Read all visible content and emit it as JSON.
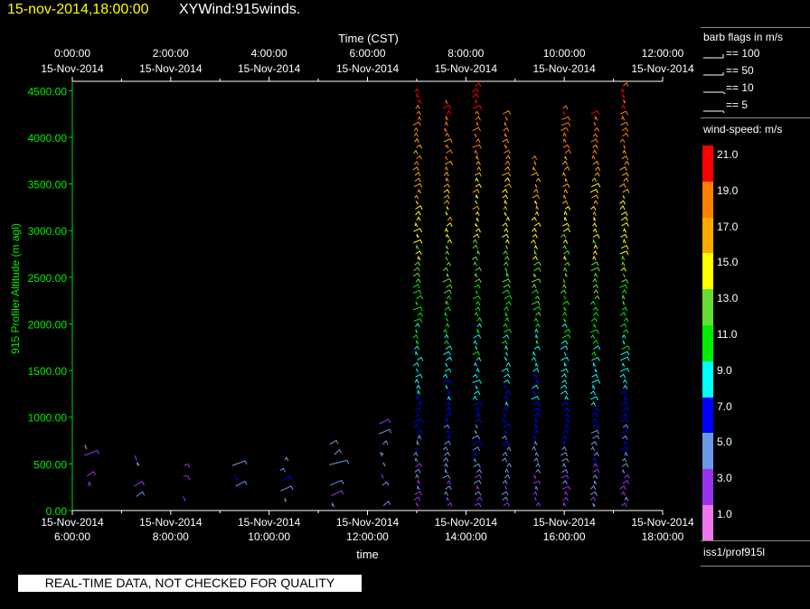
{
  "header": {
    "date_time": "15-nov-2014,18:00:00",
    "plot_name": "XYWind:915winds."
  },
  "legend": {
    "barb_title": "barb flags in m/s",
    "barbs": [
      {
        "label": "== 100",
        "icon": "barb-flag-100-icon"
      },
      {
        "label": "== 50",
        "icon": "barb-flag-50-icon"
      },
      {
        "label": "== 10",
        "icon": "barb-flag-10-icon"
      },
      {
        "label": "== 5",
        "icon": "barb-flag-5-icon"
      }
    ],
    "speed_title": "wind-speed: m/s",
    "color_scale": [
      {
        "label": "21.0",
        "color": "#ff0000"
      },
      {
        "label": "19.0",
        "color": "#ff8000"
      },
      {
        "label": "17.0",
        "color": "#ffaa00"
      },
      {
        "label": "15.0",
        "color": "#ffff00"
      },
      {
        "label": "13.0",
        "color": "#66dd33"
      },
      {
        "label": "11.0",
        "color": "#00ee00"
      },
      {
        "label": "9.0",
        "color": "#00ffff"
      },
      {
        "label": "7.0",
        "color": "#0000ff"
      },
      {
        "label": "5.0",
        "color": "#6a9ae6"
      },
      {
        "label": "3.0",
        "color": "#9a33ee"
      },
      {
        "label": "1.0",
        "color": "#ee77ee"
      }
    ],
    "source": "iss1/prof915l"
  },
  "quality_note": "REAL-TIME DATA, NOT CHECKED FOR QUALITY",
  "chart_data": {
    "type": "scatter",
    "top_axis_title": "Time (CST)",
    "xlabel": "time",
    "ylabel": "915 Profiler Altitude (m agl)",
    "ylim": [
      0,
      4600
    ],
    "x_range_hours": [
      6,
      18
    ],
    "yticks": [
      "0.00",
      "500.00",
      "1000.00",
      "1500.00",
      "2000.00",
      "2500.00",
      "3000.00",
      "3500.00",
      "4000.00",
      "4500.00"
    ],
    "bottom_ticks": [
      {
        "line1": "15-Nov-2014",
        "line2": "6:00:00"
      },
      {
        "line1": "15-Nov-2014",
        "line2": "8:00:00"
      },
      {
        "line1": "15-Nov-2014",
        "line2": "10:00:00"
      },
      {
        "line1": "15-Nov-2014",
        "line2": "12:00:00"
      },
      {
        "line1": "15-Nov-2014",
        "line2": "14:00:00"
      },
      {
        "line1": "15-Nov-2014",
        "line2": "16:00:00"
      },
      {
        "line1": "15-Nov-2014",
        "line2": "18:00:00"
      }
    ],
    "top_ticks": [
      {
        "line1": "0:00:00",
        "line2": "15-Nov-2014"
      },
      {
        "line1": "2:00:00",
        "line2": "15-Nov-2014"
      },
      {
        "line1": "4:00:00",
        "line2": "15-Nov-2014"
      },
      {
        "line1": "6:00:00",
        "line2": "15-Nov-2014"
      },
      {
        "line1": "8:00:00",
        "line2": "15-Nov-2014"
      },
      {
        "line1": "10:00:00",
        "line2": "15-Nov-2014"
      },
      {
        "line1": "12:00:00",
        "line2": "15-Nov-2014"
      }
    ],
    "grid": false,
    "series": [
      {
        "time_hours": 6.5,
        "alt_min": 150,
        "alt_max": 750,
        "speed": 3,
        "direction_deg": 220
      },
      {
        "time_hours": 7.5,
        "alt_min": 150,
        "alt_max": 600,
        "speed": 4,
        "direction_deg": 240
      },
      {
        "time_hours": 8.5,
        "alt_min": 150,
        "alt_max": 550,
        "speed": 3,
        "direction_deg": 250
      },
      {
        "time_hours": 9.5,
        "alt_min": 150,
        "alt_max": 550,
        "speed": 5,
        "direction_deg": 230
      },
      {
        "time_hours": 10.5,
        "alt_min": 100,
        "alt_max": 800,
        "speed": 6,
        "direction_deg": 210
      },
      {
        "time_hours": 11.5,
        "alt_min": 50,
        "alt_max": 1000,
        "speed": 5,
        "direction_deg": 200
      },
      {
        "time_hours": 12.5,
        "alt_min": 50,
        "alt_max": 1050,
        "speed": 4,
        "direction_deg": 210
      },
      {
        "time_hours": 13.2,
        "alt_min": 50,
        "alt_max": 4500,
        "speed": 12,
        "direction_deg": 235
      },
      {
        "time_hours": 13.8,
        "alt_min": 50,
        "alt_max": 4400,
        "speed": 13,
        "direction_deg": 235
      },
      {
        "time_hours": 14.4,
        "alt_min": 50,
        "alt_max": 4550,
        "speed": 13,
        "direction_deg": 235
      },
      {
        "time_hours": 15.0,
        "alt_min": 50,
        "alt_max": 4300,
        "speed": 12,
        "direction_deg": 235
      },
      {
        "time_hours": 15.6,
        "alt_min": 50,
        "alt_max": 3800,
        "speed": 12,
        "direction_deg": 235
      },
      {
        "time_hours": 16.2,
        "alt_min": 50,
        "alt_max": 4350,
        "speed": 13,
        "direction_deg": 235
      },
      {
        "time_hours": 16.8,
        "alt_min": 50,
        "alt_max": 4300,
        "speed": 13,
        "direction_deg": 235
      },
      {
        "time_hours": 17.4,
        "alt_min": 50,
        "alt_max": 4550,
        "speed": 13,
        "direction_deg": 235
      }
    ]
  }
}
